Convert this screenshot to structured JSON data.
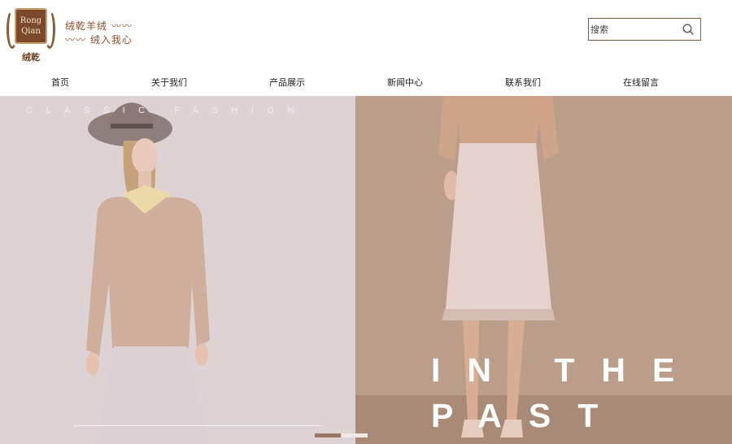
{
  "brand": {
    "logo_text_line1": "Rong",
    "logo_text_line2": "Qian",
    "logo_name": "绒乾",
    "slogan_line1": "绒乾羊绒",
    "slogan_line2": "绒入我心",
    "wave": "〰〰"
  },
  "search": {
    "placeholder": "搜索",
    "icon": "search-icon"
  },
  "nav": {
    "items": [
      {
        "label": "首页"
      },
      {
        "label": "关于我们"
      },
      {
        "label": "产品展示"
      },
      {
        "label": "新闻中心"
      },
      {
        "label": "联系我们"
      },
      {
        "label": "在线留言"
      }
    ]
  },
  "hero": {
    "left_caption": "CLASSIC FASHION",
    "right_line1": "IN THE",
    "right_line2": "PAST",
    "slide_count": 2,
    "active_slide": 1
  },
  "colors": {
    "accent": "#8a5a38",
    "left_panel_bg": "#ddd2d4",
    "right_panel_bg": "#b79a86",
    "active_dot": "#9a7a64"
  }
}
